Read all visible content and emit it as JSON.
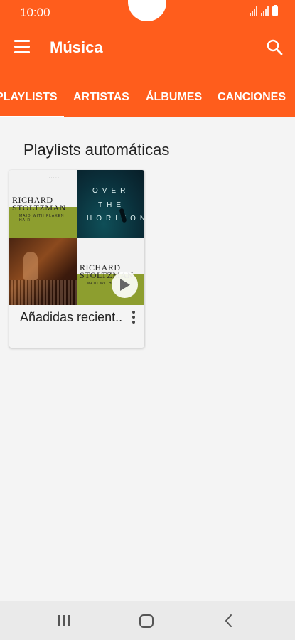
{
  "status": {
    "time": "10:00"
  },
  "app": {
    "title": "Música"
  },
  "tabs": [
    {
      "label": "PLAYLISTS",
      "active": true
    },
    {
      "label": "ARTISTAS",
      "active": false
    },
    {
      "label": "ÁLBUMES",
      "active": false
    },
    {
      "label": "CANCIONES",
      "active": false
    }
  ],
  "section": {
    "title": "Playlists automáticas"
  },
  "card": {
    "label": "Añadidas recient..",
    "artwork": {
      "a1": {
        "name_line1": "RICHARD",
        "name_line2": "STOLTZMAN",
        "subtitle": "MAID WITH FLAXEN HAIR"
      },
      "a2": {
        "line1": "OVER",
        "line2": "THE",
        "line3": "HORIZON"
      },
      "a4": {
        "name_line1": "RICHARD",
        "name_line2": "STOLTZMAN",
        "subtitle": "MAID WITH"
      }
    }
  },
  "colors": {
    "accent": "#ff5d1c",
    "background": "#f4f4f4",
    "nav": "#eaeaea"
  },
  "icons": {
    "menu": "hamburger-icon",
    "search": "search-icon",
    "play": "play-icon",
    "more": "more-vert-icon",
    "recents": "recents-icon",
    "home": "home-icon",
    "back": "back-icon"
  }
}
